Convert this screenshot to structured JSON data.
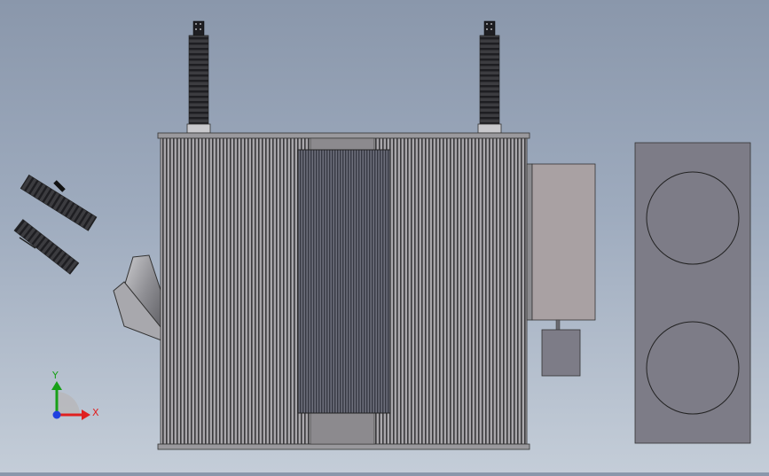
{
  "viewport": {
    "background_top": "#8a97ab",
    "background_bottom": "#c4cdd8"
  },
  "model": {
    "tank_color": "#8c8a8e",
    "fin_dark": "#3a393c",
    "fin_light": "#a9a7ab",
    "core_color": "#4a4c58",
    "terminal_box_color": "#a9a1a3",
    "radiator_panel_color": "#7d7c87"
  },
  "triad": {
    "x_label": "X",
    "y_label": "Y",
    "x_color": "#e02020",
    "y_color": "#18a018",
    "z_color": "#2040e0"
  }
}
